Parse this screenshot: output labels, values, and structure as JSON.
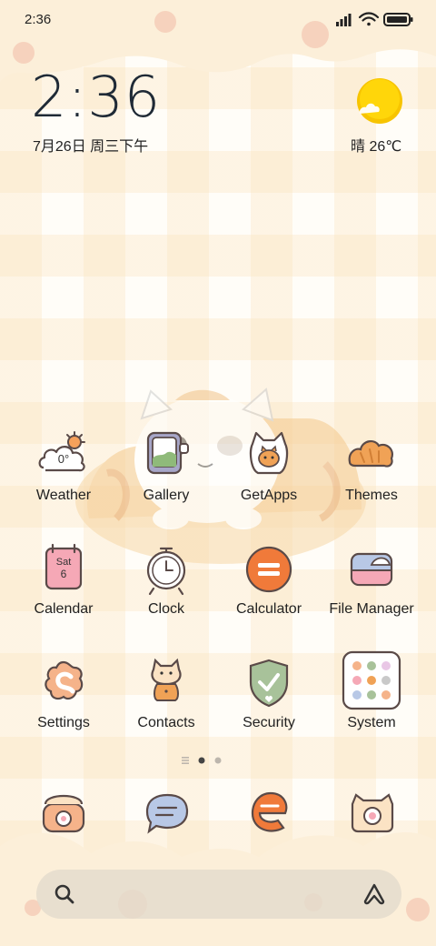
{
  "status_bar": {
    "time": "2:36"
  },
  "clock_widget": {
    "time": "2:36",
    "date": "7月26日 周三下午"
  },
  "weather_widget": {
    "text": "晴 26℃",
    "icon": "sun-cloud-icon"
  },
  "apps": [
    {
      "label": "Weather",
      "icon": "weather-icon",
      "badge": "0°"
    },
    {
      "label": "Gallery",
      "icon": "gallery-icon"
    },
    {
      "label": "GetApps",
      "icon": "getapps-icon"
    },
    {
      "label": "Themes",
      "icon": "themes-icon"
    },
    {
      "label": "Calendar",
      "icon": "calendar-icon",
      "day": "Sat",
      "date": "6"
    },
    {
      "label": "Clock",
      "icon": "clock-icon"
    },
    {
      "label": "Calculator",
      "icon": "calculator-icon"
    },
    {
      "label": "File Manager",
      "icon": "file-manager-icon"
    },
    {
      "label": "Settings",
      "icon": "settings-icon"
    },
    {
      "label": "Contacts",
      "icon": "contacts-icon"
    },
    {
      "label": "Security",
      "icon": "security-icon"
    },
    {
      "label": "System",
      "icon": "system-folder-icon"
    }
  ],
  "dock": [
    {
      "icon": "phone-icon"
    },
    {
      "icon": "messages-icon"
    },
    {
      "icon": "browser-icon"
    },
    {
      "icon": "camera-icon"
    }
  ],
  "colors": {
    "accent_orange": "#f07a3a",
    "cream": "#fbe9cf",
    "ink": "#5a4a48"
  }
}
